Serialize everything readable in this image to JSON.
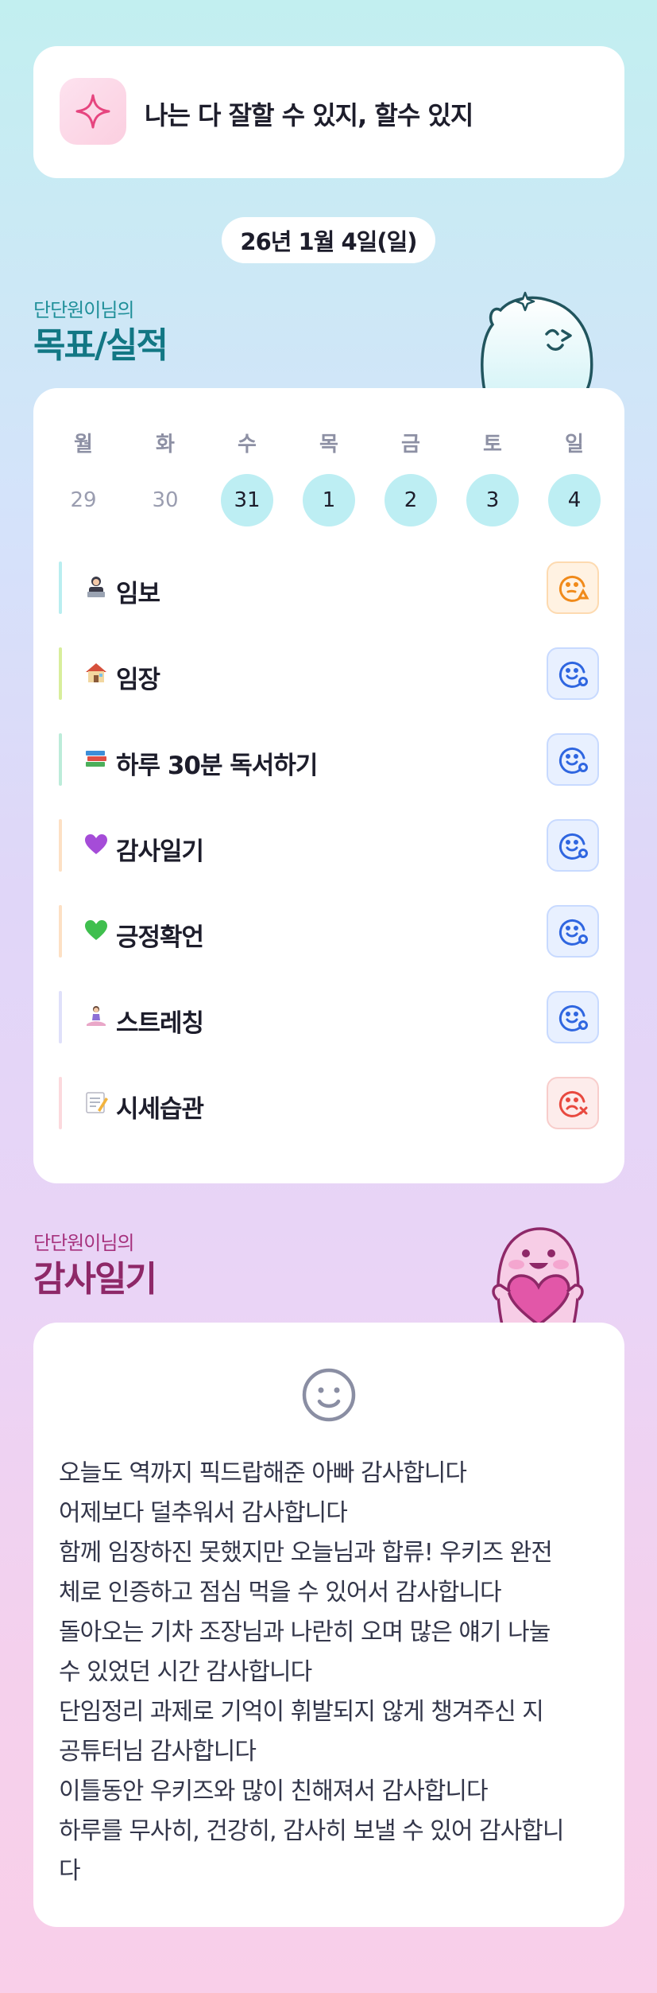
{
  "affirmation": {
    "text": "나는 다 잘할 수 있지, 할수 있지",
    "icon": "sparkle-icon"
  },
  "date": "26년 1월 4일(일)",
  "goals_section": {
    "owner": "단단원이님의",
    "title": "목표/실적",
    "weekdays": [
      "월",
      "화",
      "수",
      "목",
      "금",
      "토",
      "일"
    ],
    "days": [
      {
        "n": "29",
        "active": false
      },
      {
        "n": "30",
        "active": false
      },
      {
        "n": "31",
        "active": true
      },
      {
        "n": "1",
        "active": true
      },
      {
        "n": "2",
        "active": true
      },
      {
        "n": "3",
        "active": true
      },
      {
        "n": "4",
        "active": true
      }
    ],
    "goals": [
      {
        "label": "임보",
        "emoji": "person-laptop-icon",
        "status": "partial",
        "color": "#b9eef0"
      },
      {
        "label": "임장",
        "emoji": "house-icon",
        "status": "done",
        "color": "#d8ee9c"
      },
      {
        "label": "하루 30분 독서하기",
        "emoji": "books-icon",
        "status": "done",
        "color": "#bcecd9"
      },
      {
        "label": "감사일기",
        "emoji": "purple-heart-icon",
        "status": "done",
        "color": "#fde0c4"
      },
      {
        "label": "긍정확언",
        "emoji": "green-heart-icon",
        "status": "done",
        "color": "#fde0c4"
      },
      {
        "label": "스트레칭",
        "emoji": "person-yoga-icon",
        "status": "done",
        "color": "#dfe0fa"
      },
      {
        "label": "시세습관",
        "emoji": "memo-icon",
        "status": "fail",
        "color": "#fcd9dd"
      }
    ]
  },
  "diary_section": {
    "owner": "단단원이님의",
    "title": "감사일기",
    "lines": [
      "오늘도 역까지 픽드랍해준 아빠 감사합니다",
      "어제보다 덜추워서 감사합니다",
      "함께 임장하진 못했지만 오늘님과 합류! 우키즈 완전",
      "체로 인증하고 점심 먹을 수 있어서 감사합니다",
      "돌아오는 기차 조장님과 나란히 오며 많은 얘기 나눌",
      "수 있었던 시간 감사합니다",
      "단임정리 과제로 기억이 휘발되지 않게 챙겨주신 지",
      "공튜터님 감사합니다",
      "이틀동안 우키즈와 많이 친해져서 감사합니다",
      "하루를 무사히, 건강히, 감사히 보낼 수 있어 감사합니",
      "다"
    ]
  },
  "colors": {
    "accent_teal": "#127784",
    "accent_magenta": "#8e2868",
    "status_done": "#2f66e0",
    "status_partial": "#f08a1a",
    "status_fail": "#e8493f"
  }
}
